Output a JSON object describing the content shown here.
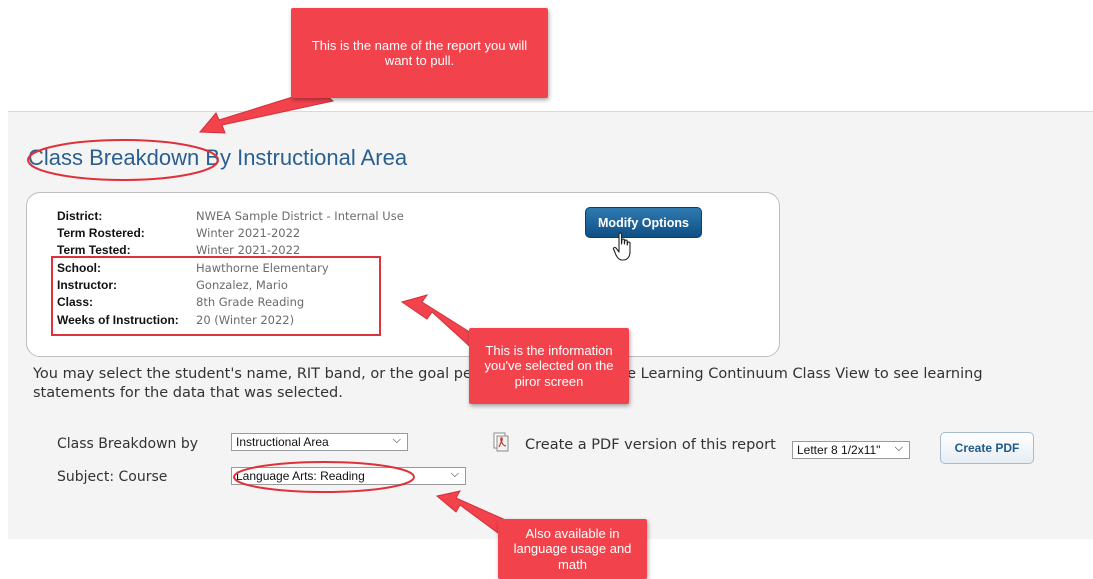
{
  "report": {
    "title": "Class Breakdown By Instructional Area",
    "modify_button": "Modify Options",
    "info": [
      {
        "label": "District:",
        "value": "NWEA Sample District - Internal Use"
      },
      {
        "label": "Term Rostered:",
        "value": "Winter 2021-2022"
      },
      {
        "label": "Term Tested:",
        "value": "Winter 2021-2022"
      },
      {
        "label": "School:",
        "value": "Hawthorne Elementary"
      },
      {
        "label": "Instructor:",
        "value": "Gonzalez, Mario"
      },
      {
        "label": "Class:",
        "value": "8th Grade Reading"
      },
      {
        "label": "Weeks of Instruction:",
        "value": "20 (Winter 2022)"
      }
    ],
    "description": "You may select the student's name, RIT band, or the goal performance to go to the Learning Continuum Class View to see learning statements for the data that was selected.",
    "controls": {
      "breakdown_label": "Class Breakdown by",
      "breakdown_value": "Instructional Area",
      "subject_label": "Subject: Course",
      "subject_value": "Language Arts: Reading",
      "pdf_text": "Create a PDF version of this report",
      "paper_value": "Letter 8 1/2x11\"",
      "create_pdf_button": "Create PDF"
    }
  },
  "callouts": {
    "report_name": "This is the name of the report you will want to pull.",
    "info_selected": "This is the information you've selected on the piror screen",
    "also_available": "Also available in language usage and math"
  },
  "colors": {
    "title_blue": "#2a6090",
    "callout_red": "#f2434d",
    "annotation_red": "#e0313b",
    "button_blue": "#1a5d92"
  },
  "icons": [
    "pdf-icon",
    "hand-cursor-icon",
    "chevron-down-icon"
  ]
}
